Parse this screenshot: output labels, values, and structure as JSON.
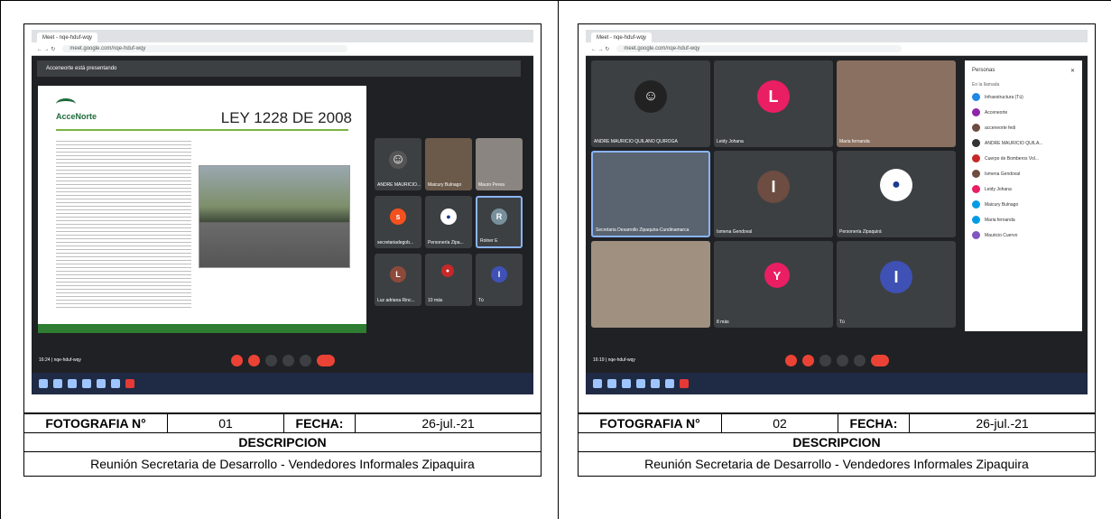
{
  "panels": [
    {
      "photo_label": "FOTOGRAFIA N°",
      "photo_number": "01",
      "date_label": "FECHA:",
      "date_value": "26-jul.-21",
      "description_header": "DESCRIPCION",
      "description_text": "Reunión Secretaria de Desarrollo - Vendedores Informales Zipaquira",
      "screenshot": {
        "presenting_banner": "Acceneorte está presentando",
        "slide_logo": "AcceNorte",
        "slide_title": "LEY 1228 DE 2008",
        "meet_code": "16:24 | nqe-hduf-wqy",
        "tiles": [
          "ANDRE MAURICIO...",
          "Maicury Bulnago",
          "Mauro Perea",
          "secretariadegob...",
          "Personería Zipa...",
          "Rolner E",
          "Luz adriana Rinc...",
          "10 más",
          "Tú"
        ]
      }
    },
    {
      "photo_label": "FOTOGRAFIA N°",
      "photo_number": "02",
      "date_label": "FECHA:",
      "date_value": "26-jul.-21",
      "description_header": "DESCRIPCION",
      "description_text": "Reunión Secretaria de Desarrollo - Vendedores Informales Zipaquira",
      "screenshot": {
        "meet_code": "16:19 | nqe-hduf-wqy",
        "people_title": "Personas",
        "people_sub": "En la llamada",
        "people": [
          "Infraestructura (Tú)",
          "Acceneorte",
          "acceneorte fedi",
          "ANDRE MAURICIO QUILA...",
          "Cuerpo de Bomberos Vol...",
          "Ismena Gendoval",
          "Leidy Johana",
          "Maicury Bulnago",
          "Maria fernanda",
          "Mauricio Cuervo"
        ],
        "tiles": [
          "ANDRE MAURICIO QUILANO QUIROGA",
          "Leidy Johana",
          "Maria fernanda",
          "Secretaria Desarrollo Zipaquira-Cundinamarca",
          "Ismena Gendoval",
          "Personería Zipaquirá",
          "",
          "8 más",
          "Tú"
        ]
      }
    }
  ],
  "colors": {
    "meet_bg": "#202124",
    "end_call": "#ea4335",
    "brand_green": "#2e7d32"
  }
}
